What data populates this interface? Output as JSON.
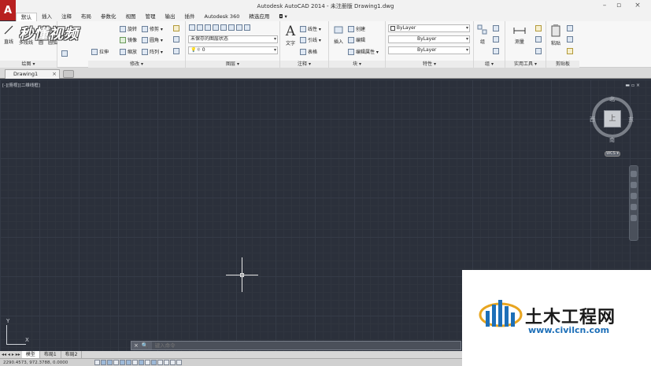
{
  "window": {
    "title": "Autodesk AutoCAD 2014 - 未注册版      Drawing1.dwg",
    "logo": "A"
  },
  "ribbon_tabs": [
    "默认",
    "插入",
    "注释",
    "布局",
    "参数化",
    "视图",
    "管理",
    "输出",
    "插件",
    "Autodesk 360",
    "精选应用",
    "◘ ▾"
  ],
  "draw_panel": {
    "label": "绘图 ▾",
    "line": "直线",
    "polyline": "多段线",
    "circle": "圆",
    "arc": "圆弧"
  },
  "modify_panel": {
    "label": "修改 ▾",
    "rotate": "旋转",
    "trim": "修剪 ▾",
    "mirror": "镜像",
    "fillet": "圆角 ▾",
    "stretch": "拉伸",
    "scale": "缩放",
    "array": "阵列 ▾"
  },
  "layers_panel": {
    "label": "图层 ▾",
    "layer_state": "未保存的图层状态",
    "current_layer": "0"
  },
  "annotation_panel": {
    "label": "注释 ▾",
    "text": "文字",
    "dim": "线性 ▾",
    "leader": "引线 ▾",
    "table": "表格"
  },
  "block_panel": {
    "label": "块 ▾",
    "insert": "插入",
    "create": "创建",
    "edit": "编辑",
    "edit_attr": "编辑属性 ▾"
  },
  "properties_panel": {
    "label": "特性 ▾",
    "color": "ByLayer",
    "linetype": "ByLayer",
    "lineweight": "ByLayer"
  },
  "groups_panel": {
    "label": "组 ▾",
    "group": "组"
  },
  "utilities_panel": {
    "label": "实用工具 ▾",
    "measure": "测量"
  },
  "clipboard_panel": {
    "label": "剪贴板",
    "paste": "粘贴"
  },
  "watermark": "秒懂视频",
  "doc_tab": {
    "name": "Drawing1",
    "close": "×"
  },
  "viewport": {
    "label": "[-][俯视][二维线框]",
    "controls": "▬ ▫ ×"
  },
  "viewcube": {
    "top": "上",
    "north": "北",
    "south": "南",
    "east": "东",
    "west": "西",
    "wcs": "WCS ▾"
  },
  "ucs": {
    "x": "X",
    "y": "Y"
  },
  "command_line": {
    "placeholder": "键入命令",
    "close": "×",
    "search": "🔍"
  },
  "layout_tabs": [
    "模型",
    "布局1",
    "布局2"
  ],
  "status": {
    "coords": "2290.4573, 972.3788, 0.0000"
  },
  "promo": {
    "brand": "土木工程网",
    "url": "www.civilcn.com"
  }
}
